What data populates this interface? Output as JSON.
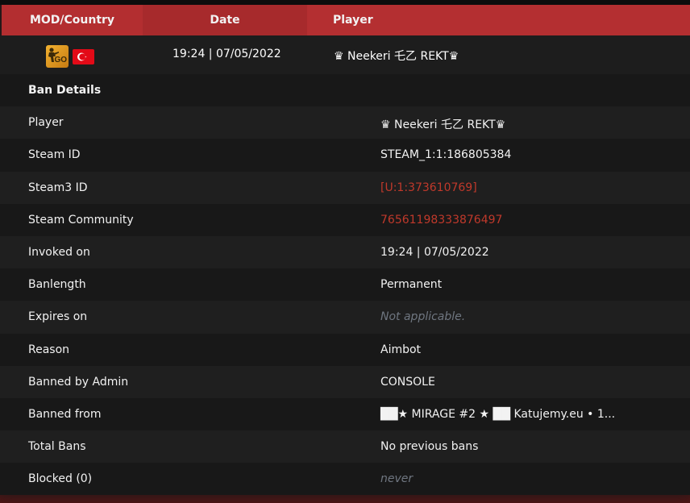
{
  "header": {
    "mod_country": "MOD/Country",
    "date": "Date",
    "player": "Player"
  },
  "summary": {
    "date": "19:24 | 07/05/2022",
    "player": "♛ Neekeri 乇乙 REKT♛",
    "mod_icon_text": "GO"
  },
  "details": {
    "title": "Ban Details",
    "rows": [
      {
        "label": "Player",
        "value": "♛ Neekeri 乇乙 REKT♛"
      },
      {
        "label": "Steam ID",
        "value": "STEAM_1:1:186805384"
      },
      {
        "label": "Steam3 ID",
        "value": "[U:1:373610769]"
      },
      {
        "label": "Steam Community",
        "value": "76561198333876497"
      },
      {
        "label": "Invoked on",
        "value": "19:24 | 07/05/2022"
      },
      {
        "label": "Banlength",
        "value": "Permanent"
      },
      {
        "label": "Expires on",
        "value": "Not applicable."
      },
      {
        "label": "Reason",
        "value": "Aimbot"
      },
      {
        "label": "Banned by Admin",
        "value": "CONSOLE"
      },
      {
        "label": "Banned from",
        "value": "██★ MIRAGE #2 ★ ██ Katujemy.eu • 1..."
      },
      {
        "label": "Total Bans",
        "value": "No previous bans"
      },
      {
        "label": "Blocked (0)",
        "value": "never"
      }
    ]
  },
  "colors": {
    "header_red": "#b22e2f",
    "link_red": "#c0392b",
    "muted": "#6f7680"
  }
}
